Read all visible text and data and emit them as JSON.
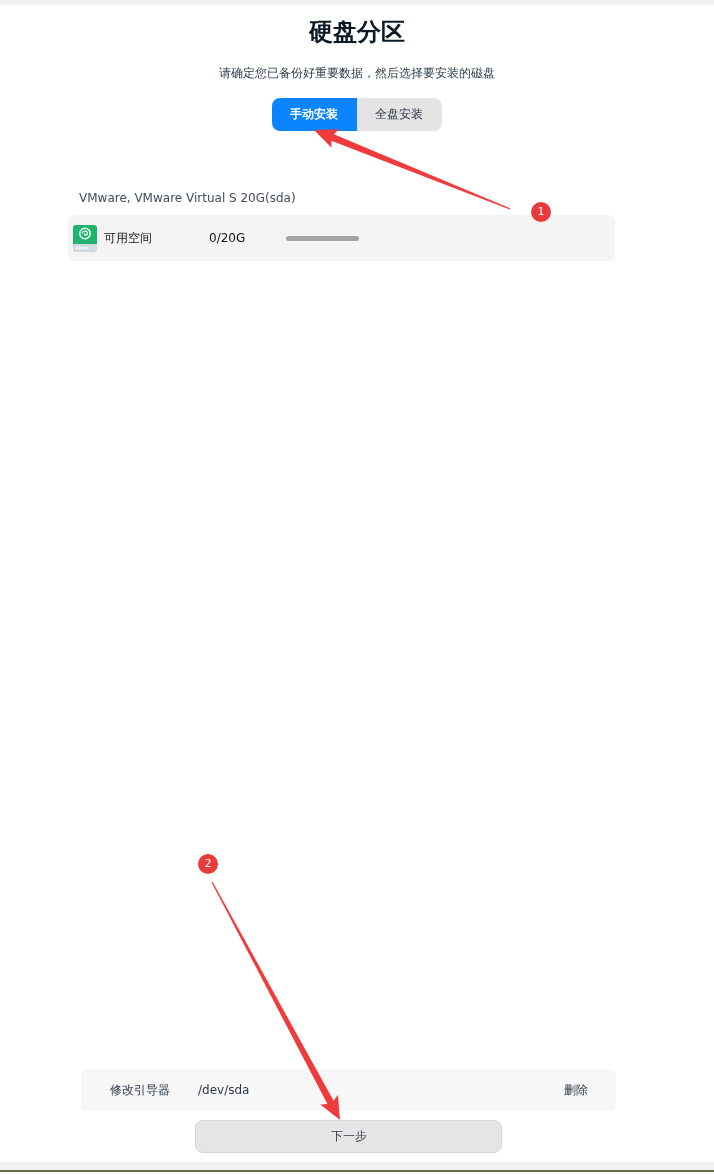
{
  "page": {
    "title": "硬盘分区",
    "subtitle": "请确定您已备份好重要数据，然后选择要安装的磁盘"
  },
  "tabs": [
    {
      "label": "手动安装",
      "selected": true
    },
    {
      "label": "全盘安装",
      "selected": false
    }
  ],
  "disk": {
    "name": "VMware, VMware Virtual S 20G(sda)",
    "partitions": [
      {
        "label": "可用空间",
        "size": "0/20G"
      }
    ]
  },
  "bootloader": {
    "label": "修改引导器",
    "device": "/dev/sda",
    "action": "删除"
  },
  "next_button": {
    "label": "下一步"
  },
  "annotations": [
    {
      "label": "1"
    },
    {
      "label": "2"
    }
  ]
}
